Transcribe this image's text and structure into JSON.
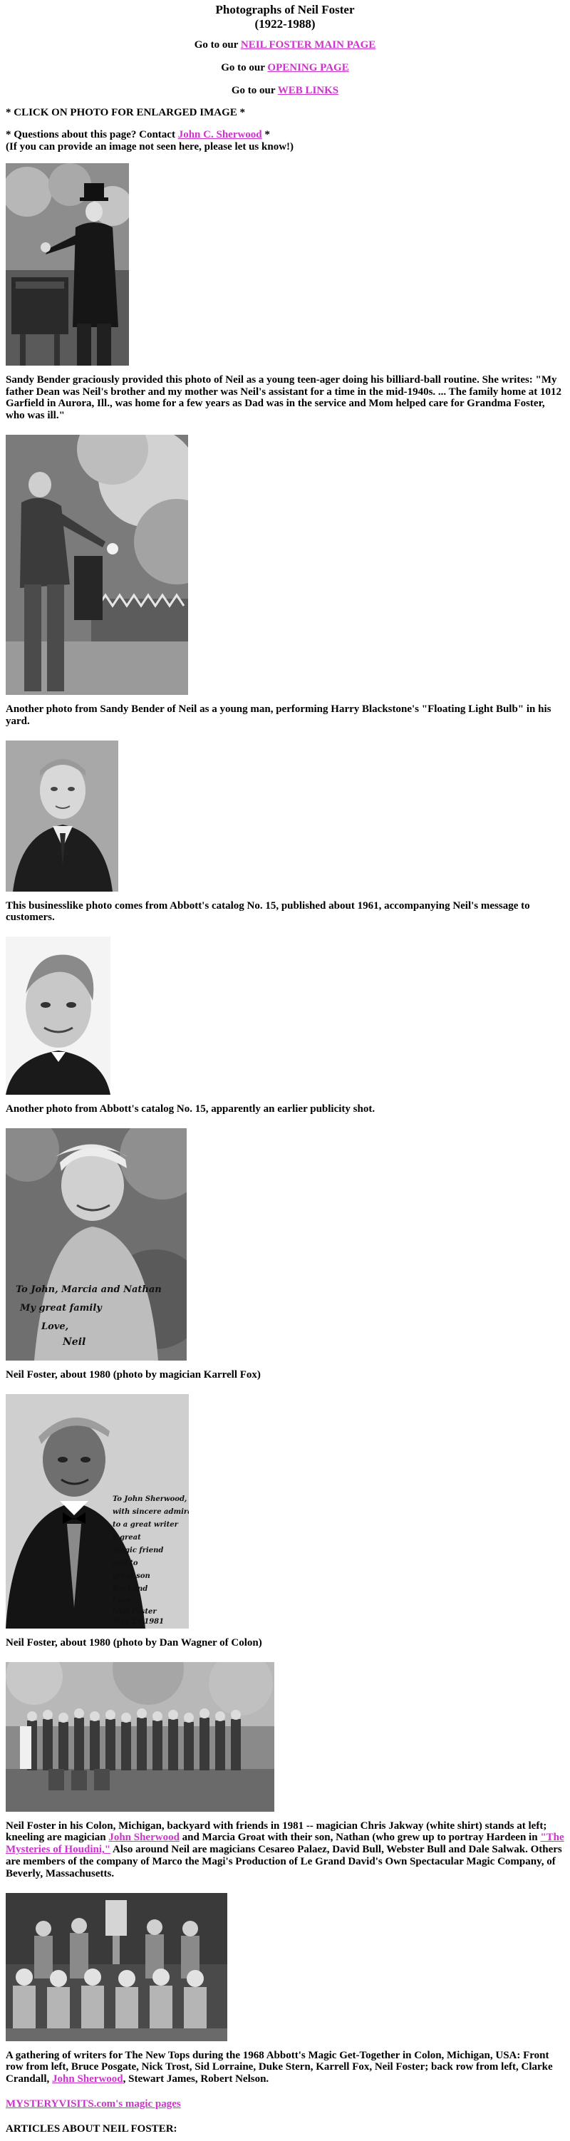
{
  "title": {
    "line1": "Photographs of Neil Foster",
    "line2": "(1922-1988)"
  },
  "nav": [
    {
      "prefix": "Go to our ",
      "link": "NEIL FOSTER MAIN PAGE"
    },
    {
      "prefix": "Go to our ",
      "link": "OPENING PAGE"
    },
    {
      "prefix": "Go to our ",
      "link": "WEB LINKS"
    }
  ],
  "instructions": {
    "click": "* CLICK ON PHOTO FOR ENLARGED IMAGE *",
    "questions_prefix": "* Questions about this page? Contact ",
    "contact_link": "John C. Sherwood",
    "questions_suffix": " *",
    "image_request": "(If you can provide an image not seen here, please let us know!)"
  },
  "photos": [
    {
      "caption": "Sandy Bender graciously provided this photo of Neil as a young teen-ager doing his billiard-ball routine. She writes: \"My father Dean was Neil's brother and my mother was Neil's assistant for a time in the mid-1940s. ... The family home at 1012 Garfield in Aurora, Ill., was home for a few years as Dad was in the service and Mom helped care for Grandma Foster, who was ill.\""
    },
    {
      "caption": "Another photo from Sandy Bender of Neil as a young man, performing Harry Blackstone's \"Floating Light Bulb\" in his yard."
    },
    {
      "caption": "This businesslike photo comes from Abbott's catalog No. 15, published about 1961, accompanying Neil's message to customers."
    },
    {
      "caption": "Another photo from Abbott's catalog No. 15, apparently an earlier publicity shot."
    },
    {
      "caption": "Neil Foster, about 1980 (photo by magician Karrell Fox)"
    },
    {
      "caption": "Neil Foster, about 1980 (photo by Dan Wagner of Colon)"
    },
    {
      "caption_a": "Neil Foster in his Colon, Michigan, backyard with friends in 1981 -- magician Chris Jakway (white shirt) stands at left; kneeling are magician ",
      "link_a": "John Sherwood",
      "caption_b": " and Marcia Groat with their son, Nathan (who grew up to portray Hardeen in ",
      "link_b": "\"The Mysteries of Houdini,\"",
      "caption_c": " Also around Neil are magicians Cesareo Palaez, David Bull, Webster Bull and Dale Salwak. Others are members of the company of Marco the Magi's Production of Le Grand David's Own Spectacular Magic Company, of Beverly, Massachusetts."
    },
    {
      "caption_a": "A gathering of writers for The New Tops during the 1968 Abbott's Magic Get-Together in Colon, Michigan, USA: Front row from left, Bruce Posgate, Nick Trost, Sid Lorraine, Duke Stern, Karrell Fox, Neil Foster; back row from left, Clarke Crandall, ",
      "link_a": "John Sherwood",
      "caption_b": ", Stewart James, Robert Nelson."
    }
  ],
  "footer": {
    "link": "MYSTERYVISITS.com's magic pages",
    "articles_heading": "ARTICLES ABOUT NEIL FOSTER:"
  },
  "colors": {
    "link": "#cc33cc",
    "text": "#000000",
    "background": "#ffffff"
  }
}
